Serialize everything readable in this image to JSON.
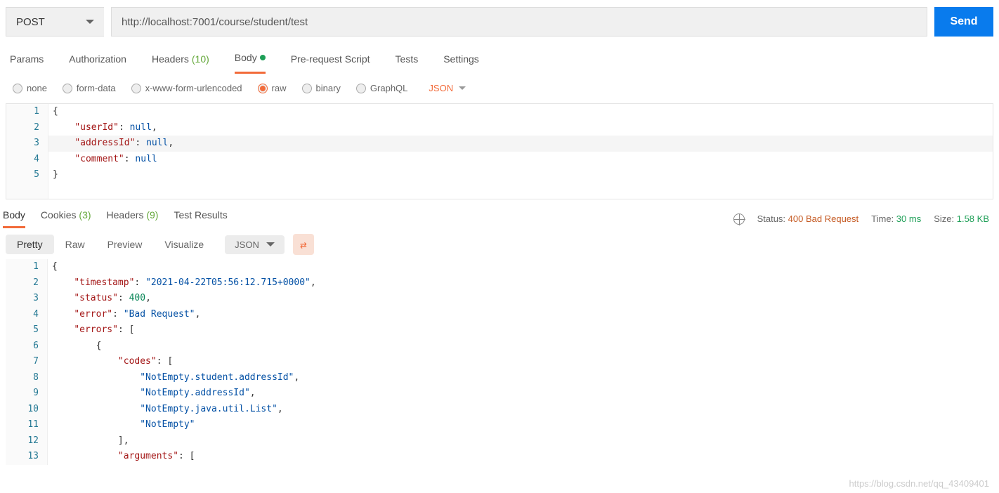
{
  "request": {
    "method": "POST",
    "url": "http://localhost:7001/course/student/test",
    "sendLabel": "Send"
  },
  "reqTabs": {
    "params": "Params",
    "authorization": "Authorization",
    "headers": "Headers",
    "headersCount": "(10)",
    "body": "Body",
    "preRequest": "Pre-request Script",
    "tests": "Tests",
    "settings": "Settings"
  },
  "bodyOpts": {
    "none": "none",
    "formData": "form-data",
    "urlencoded": "x-www-form-urlencoded",
    "raw": "raw",
    "binary": "binary",
    "graphql": "GraphQL",
    "jsonLabel": "JSON"
  },
  "reqBody": {
    "lines": [
      "1",
      "2",
      "3",
      "4",
      "5"
    ],
    "l1": "{",
    "l2_key": "\"userId\"",
    "l2_punc1": ": ",
    "l2_val": "null",
    "l2_punc2": ",",
    "l3_key": "\"addressId\"",
    "l3_punc1": ": ",
    "l3_val": "null",
    "l3_punc2": ",",
    "l4_key": "\"comment\"",
    "l4_punc1": ": ",
    "l4_val": "null",
    "l5": "}"
  },
  "respTabs": {
    "body": "Body",
    "cookies": "Cookies",
    "cookiesCount": "(3)",
    "headers": "Headers",
    "headersCount": "(9)",
    "testResults": "Test Results"
  },
  "respMeta": {
    "statusLabel": "Status:",
    "statusValue": "400 Bad Request",
    "timeLabel": "Time:",
    "timeValue": "30 ms",
    "sizeLabel": "Size:",
    "sizeValue": "1.58 KB"
  },
  "viewOptions": {
    "pretty": "Pretty",
    "raw": "Raw",
    "preview": "Preview",
    "visualize": "Visualize",
    "json": "JSON"
  },
  "respBody": {
    "lines": [
      "1",
      "2",
      "3",
      "4",
      "5",
      "6",
      "7",
      "8",
      "9",
      "10",
      "11",
      "12",
      "13"
    ],
    "l1": "{",
    "l2_key": "\"timestamp\"",
    "l2_p1": ": ",
    "l2_val": "\"2021-04-22T05:56:12.715+0000\"",
    "l2_p2": ",",
    "l3_key": "\"status\"",
    "l3_p1": ": ",
    "l3_val": "400",
    "l3_p2": ",",
    "l4_key": "\"error\"",
    "l4_p1": ": ",
    "l4_val": "\"Bad Request\"",
    "l4_p2": ",",
    "l5_key": "\"errors\"",
    "l5_p1": ": [",
    "l6": "{",
    "l7_key": "\"codes\"",
    "l7_p1": ": [",
    "l8_val": "\"NotEmpty.student.addressId\"",
    "l8_p2": ",",
    "l9_val": "\"NotEmpty.addressId\"",
    "l9_p2": ",",
    "l10_val": "\"NotEmpty.java.util.List\"",
    "l10_p2": ",",
    "l11_val": "\"NotEmpty\"",
    "l12": "],",
    "l13_key": "\"arguments\"",
    "l13_p1": ": ["
  },
  "watermark": "https://blog.csdn.net/qq_43409401"
}
